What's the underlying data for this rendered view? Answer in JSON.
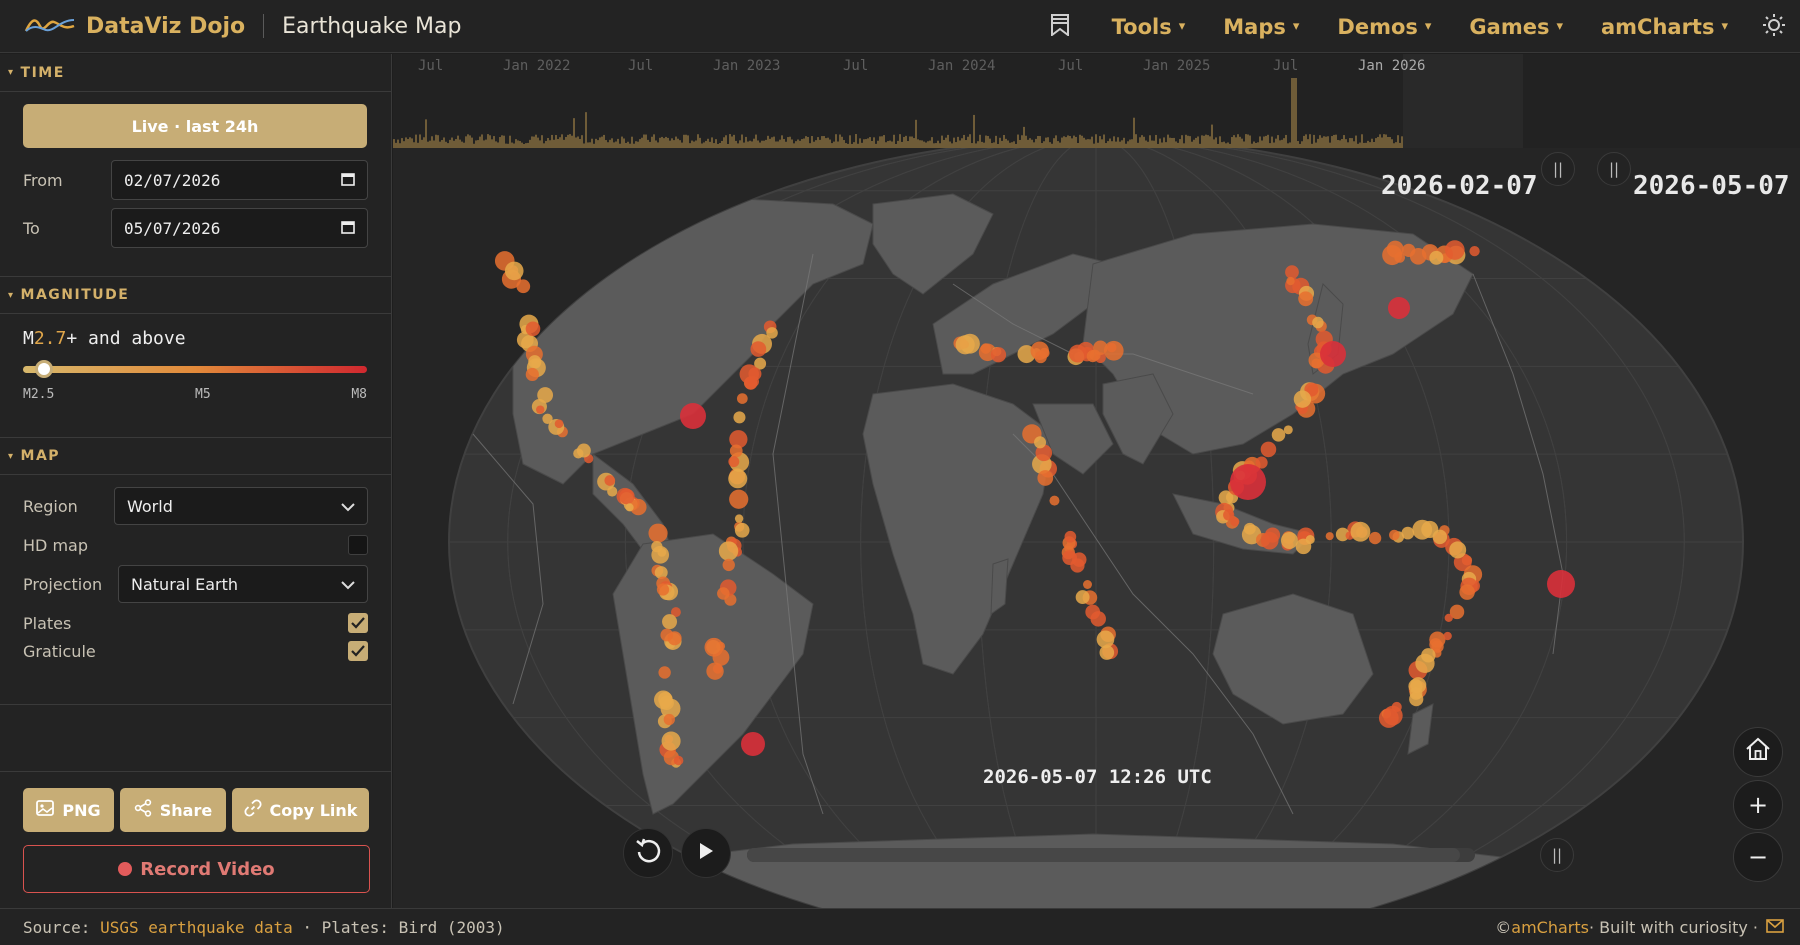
{
  "brand": {
    "name": "DataViz Dojo",
    "page_title": "Earthquake Map"
  },
  "nav": {
    "items": [
      "Tools",
      "Maps",
      "Demos",
      "Games",
      "amCharts"
    ]
  },
  "sidebar": {
    "time": {
      "heading": "TIME",
      "live_button": "Live · last 24h",
      "from_label": "From",
      "from_value": "02/07/2026",
      "to_label": "To",
      "to_value": "05/07/2026"
    },
    "magnitude": {
      "heading": "MAGNITUDE",
      "prefix": "M",
      "value": "2.7",
      "suffix": "+ and above",
      "slider_fraction": 0.036,
      "ticks": [
        "M2.5",
        "M5",
        "M8"
      ]
    },
    "map": {
      "heading": "MAP",
      "region_label": "Region",
      "region_value": "World",
      "hd_label": "HD map",
      "hd_checked": false,
      "projection_label": "Projection",
      "projection_value": "Natural Earth",
      "plates_label": "Plates",
      "plates_checked": true,
      "graticule_label": "Graticule",
      "graticule_checked": true
    },
    "actions": {
      "png": "PNG",
      "share": "Share",
      "copy_link": "Copy Link",
      "record": "Record Video"
    }
  },
  "timeline": {
    "ticks": [
      "Jul",
      "Jan 2022",
      "Jul",
      "Jan 2023",
      "Jul",
      "Jan 2024",
      "Jul",
      "Jan 2025",
      "Jul",
      "Jan 2026"
    ],
    "range_start": "2026-02-07",
    "range_end": "2026-05-07",
    "current_time": "2026-05-07 12:26 UTC",
    "playback_progress": 0.98
  },
  "footer": {
    "source_prefix": "Source: ",
    "source_link": "USGS earthquake data",
    "plates_text": " · Plates: Bird (2003)",
    "copyright_prefix": "© ",
    "copyright_link": "amCharts",
    "built": " · Built with curiosity ·"
  },
  "colors": {
    "accent": "#d9b15f",
    "button": "#c7ad76",
    "quake_small": "#e8a94a",
    "quake_mid": "#e8702f",
    "quake_large": "#d9303a",
    "land": "#595959",
    "ocean": "#333333"
  }
}
